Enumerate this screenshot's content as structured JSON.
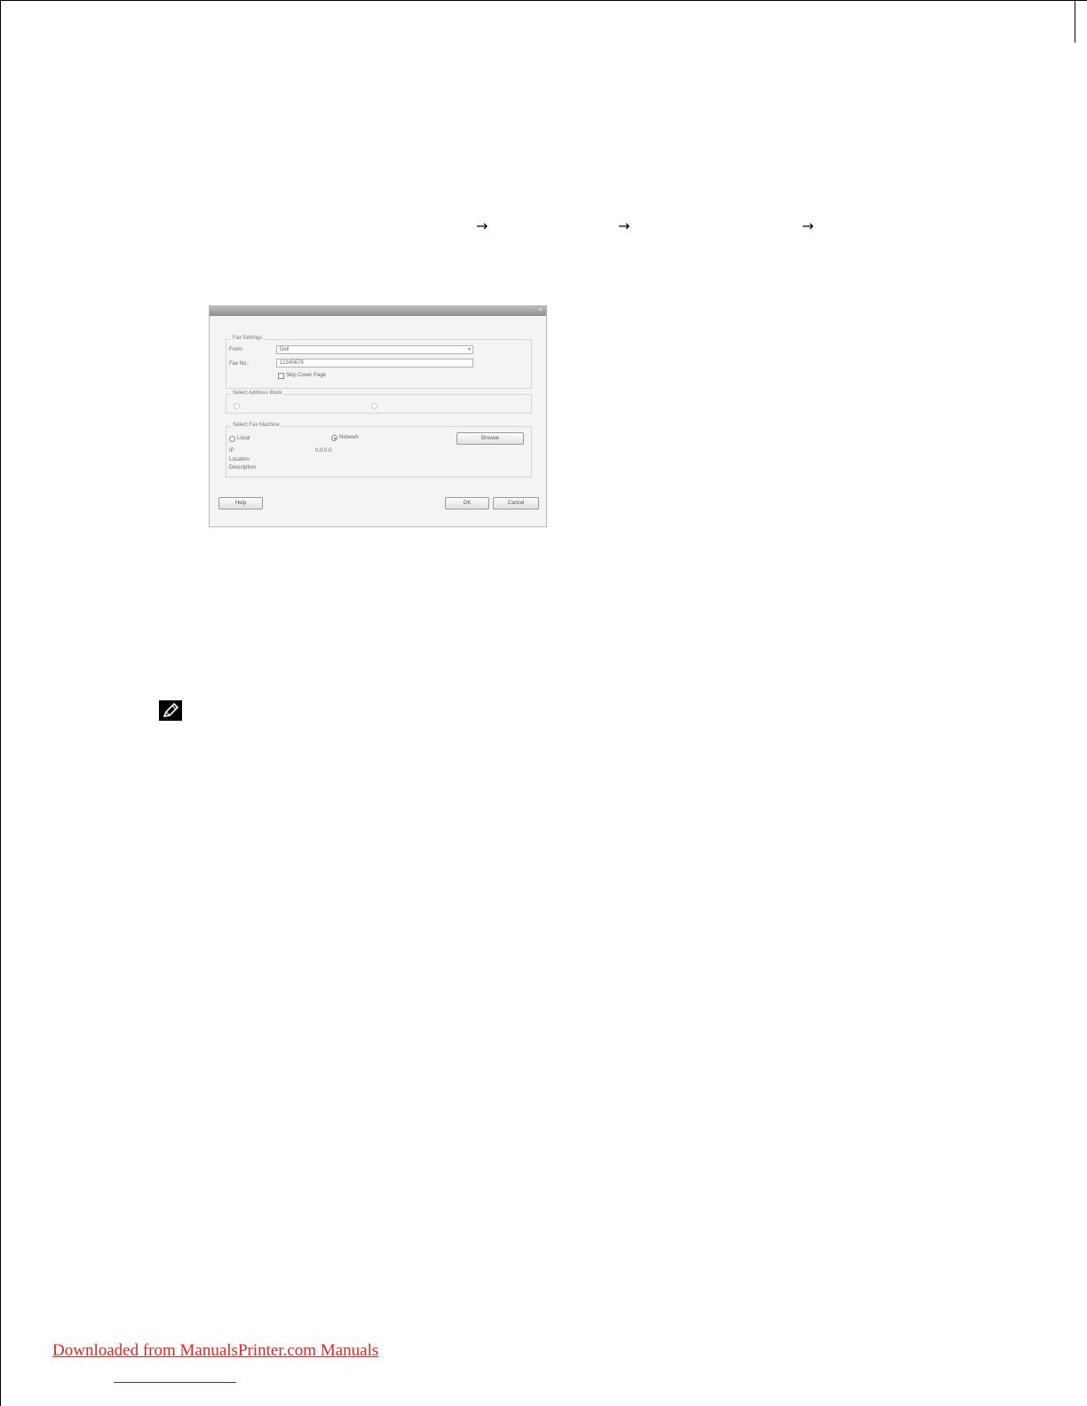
{
  "breadcrumb_arrows": [
    "→",
    "→",
    "→"
  ],
  "dialog": {
    "title": "",
    "close_glyph": "×",
    "fax_settings": {
      "group_label": "Fax Settings",
      "from_label": "From:",
      "from_value": "Dell",
      "fax_no_label": "Fax No.:",
      "fax_no_value": "12345678",
      "skip_cover_label": "Skip Cover Page"
    },
    "address_book": {
      "group_label": "Select Address Book",
      "option_left": "",
      "option_right": ""
    },
    "fax_machine": {
      "group_label": "Select Fax Machine",
      "local_label": "Local",
      "network_label": "Network",
      "browse_label": "Browse",
      "ip_label": "IP",
      "ip_value": "0.0.0.0",
      "location_label": "Location",
      "description_label": "Description"
    },
    "buttons": {
      "help": "Help",
      "ok": "OK",
      "cancel": "Cancel"
    }
  },
  "footer": {
    "link_text": "Downloaded from ManualsPrinter.com Manuals"
  },
  "colors": {
    "footer_link": "#e0271f",
    "footer_rule": "#2a3fb3"
  },
  "icons": {
    "note": "pencil-note-icon"
  }
}
